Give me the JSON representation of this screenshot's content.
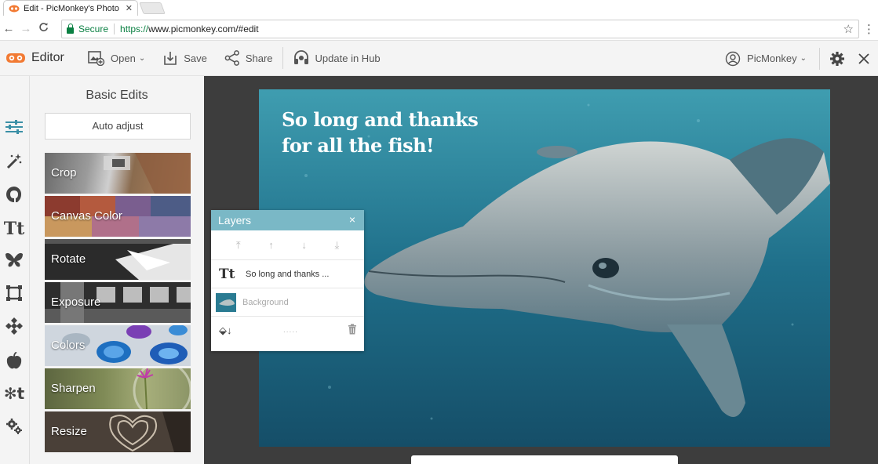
{
  "browser": {
    "tab_title": "Edit - PicMonkey's Photo",
    "tab_close": "✕",
    "secure_label": "Secure",
    "url_scheme": "https://",
    "url_rest": "www.picmonkey.com/#edit"
  },
  "app": {
    "brand": "Editor",
    "brand_color": "#f27a33",
    "toolbar": {
      "open": "Open",
      "save": "Save",
      "share": "Share",
      "update": "Update in Hub"
    },
    "account": "PicMonkey"
  },
  "sidebar_icons": [
    "sliders-icon",
    "magic-wand-icon",
    "face-icon",
    "text-icon",
    "butterfly-icon",
    "frame-icon",
    "texture-icon",
    "apple-icon",
    "themes-icon",
    "settings-gears-icon"
  ],
  "panel": {
    "title": "Basic Edits",
    "auto_adjust": "Auto adjust",
    "tiles": [
      {
        "label": "Crop"
      },
      {
        "label": "Canvas Color"
      },
      {
        "label": "Rotate"
      },
      {
        "label": "Exposure"
      },
      {
        "label": "Colors"
      },
      {
        "label": "Sharpen"
      },
      {
        "label": "Resize"
      }
    ]
  },
  "photo": {
    "line1": "So long and thanks",
    "line2": "for all the fish!"
  },
  "layers": {
    "title": "Layers",
    "close": "×",
    "tools": [
      "⤒",
      "↑",
      "↓",
      "⤓"
    ],
    "text_layer_icon": "Tt",
    "text_layer": "So long and thanks ...",
    "background_layer": "Background",
    "merge_icon": "⬙↓",
    "dots": "....."
  }
}
